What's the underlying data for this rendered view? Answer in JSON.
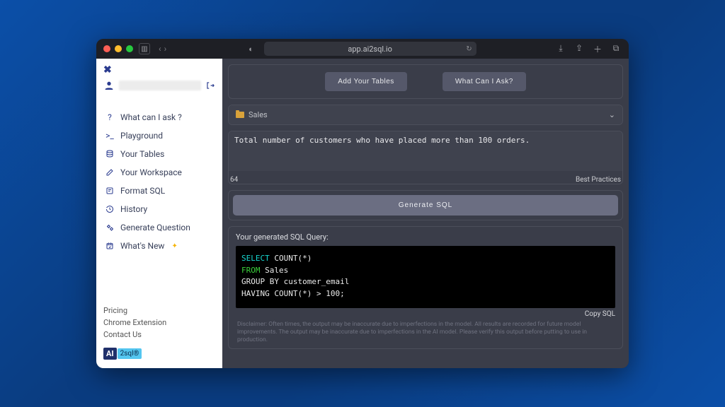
{
  "browser": {
    "url": "app.ai2sql.io"
  },
  "sidebar": {
    "user_name": "",
    "nav": [
      {
        "label": "What can I ask ?"
      },
      {
        "label": "Playground"
      },
      {
        "label": "Your Tables"
      },
      {
        "label": "Your Workspace"
      },
      {
        "label": "Format SQL"
      },
      {
        "label": "History"
      },
      {
        "label": "Generate Question"
      },
      {
        "label": "What's New"
      }
    ],
    "footer": {
      "pricing": "Pricing",
      "chrome": "Chrome Extension",
      "contact": "Contact Us"
    },
    "logo": {
      "ai": "AI",
      "rest": "2sql®"
    }
  },
  "content": {
    "buttons": {
      "add_tables": "Add Your Tables",
      "what_ask": "What Can I Ask?"
    },
    "dataset_select": "Sales",
    "query_text": "Total number of customers who have placed more than 100 orders.",
    "char_count": "64",
    "best_practices": "Best Practices",
    "generate_label": "Generate SQL",
    "result_title": "Your generated SQL Query:",
    "sql": {
      "select": "SELECT",
      "count": " COUNT(*)",
      "from": "FROM",
      "table": " Sales",
      "group": "GROUP BY customer_email",
      "having": "HAVING COUNT(*) > 100;"
    },
    "copy_label": "Copy SQL",
    "disclaimer": "Disclaimer: Often times, the output may be inaccurate due to imperfections in the model. All results are recorded for future model improvements. The output may be inaccurate due to imperfections in the AI model. Please verify this output before putting to use in production."
  }
}
